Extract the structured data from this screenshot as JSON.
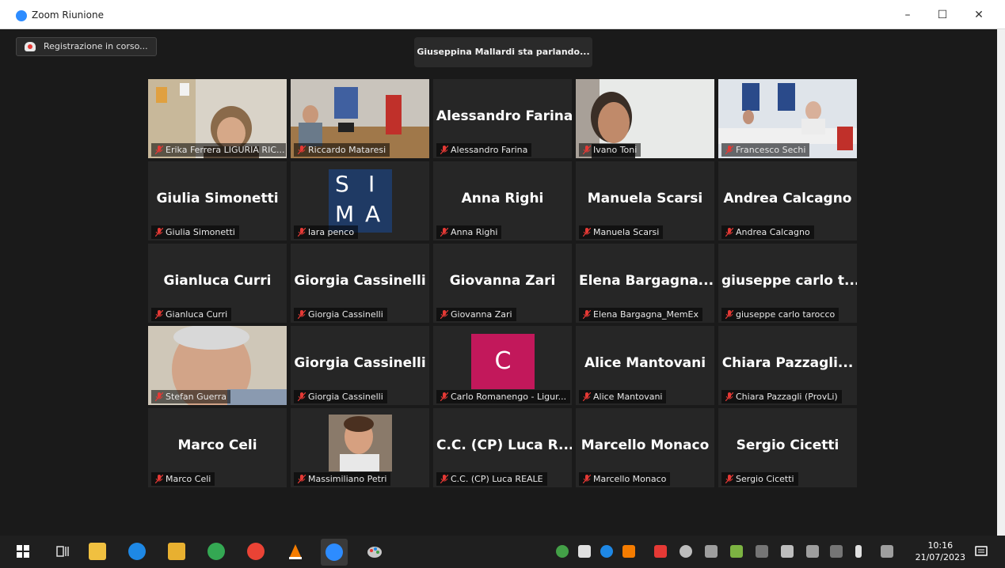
{
  "window": {
    "title": "Zoom Riunione",
    "minimize": "–",
    "maximize": "☐",
    "close": "✕"
  },
  "recording": {
    "label": "Registrazione in corso..."
  },
  "speaking": {
    "label": "Giuseppina Mallardi sta parlando..."
  },
  "tiles": [
    {
      "label": "Erika Ferrera LIGURIA RIC...",
      "big": ""
    },
    {
      "label": "Riccardo Mataresi",
      "big": ""
    },
    {
      "label": "Alessandro Farina",
      "big": "Alessandro Farina"
    },
    {
      "label": "Ivano Toni",
      "big": ""
    },
    {
      "label": "Francesco Sechi",
      "big": ""
    },
    {
      "label": "Giulia Simonetti",
      "big": "Giulia Simonetti"
    },
    {
      "label": "lara penco",
      "big": ""
    },
    {
      "label": "Anna Righi",
      "big": "Anna Righi"
    },
    {
      "label": "Manuela Scarsi",
      "big": "Manuela Scarsi"
    },
    {
      "label": "Andrea Calcagno",
      "big": "Andrea Calcagno"
    },
    {
      "label": "Gianluca Curri",
      "big": "Gianluca Curri"
    },
    {
      "label": "Giorgia Cassinelli",
      "big": "Giorgia Cassinelli"
    },
    {
      "label": "Giovanna Zari",
      "big": "Giovanna Zari"
    },
    {
      "label": "Elena Bargagna_MemEx",
      "big": "Elena Bargagna..."
    },
    {
      "label": "giuseppe carlo tarocco",
      "big": "giuseppe carlo t..."
    },
    {
      "label": "Stefan Guerra",
      "big": ""
    },
    {
      "label": "Giorgia Cassinelli",
      "big": "Giorgia Cassinelli"
    },
    {
      "label": "Carlo Romanengo - Ligur...",
      "big": ""
    },
    {
      "label": "Alice Mantovani",
      "big": "Alice Mantovani"
    },
    {
      "label": "Chiara Pazzagli (ProvLi)",
      "big": "Chiara Pazzagli..."
    },
    {
      "label": "Marco Celi",
      "big": "Marco Celi"
    },
    {
      "label": "Massimiliano Petri",
      "big": ""
    },
    {
      "label": "C.C. (CP) Luca REALE",
      "big": "C.C. (CP) Luca R..."
    },
    {
      "label": "Marcello Monaco",
      "big": "Marcello Monaco"
    },
    {
      "label": "Sergio Cicetti",
      "big": "Sergio Cicetti"
    }
  ],
  "sima": {
    "l1": "S",
    "l2": "I",
    "l3": "M",
    "l4": "A"
  },
  "carlo_avatar": {
    "letter": "C"
  },
  "colors": {
    "accent": "#2d8cff",
    "mute": "#e53935",
    "sima": "#1f3a64",
    "carlo": "#c2185b"
  },
  "taskbar": {
    "icons": [
      "windows-start-icon",
      "task-view-icon",
      "store-icon",
      "edge-icon",
      "file-explorer-icon",
      "chrome-icon",
      "chrome-profile-icon",
      "vlc-icon",
      "zoom-icon",
      "paint-icon"
    ],
    "time": "10:16",
    "date": "21/07/2023"
  }
}
